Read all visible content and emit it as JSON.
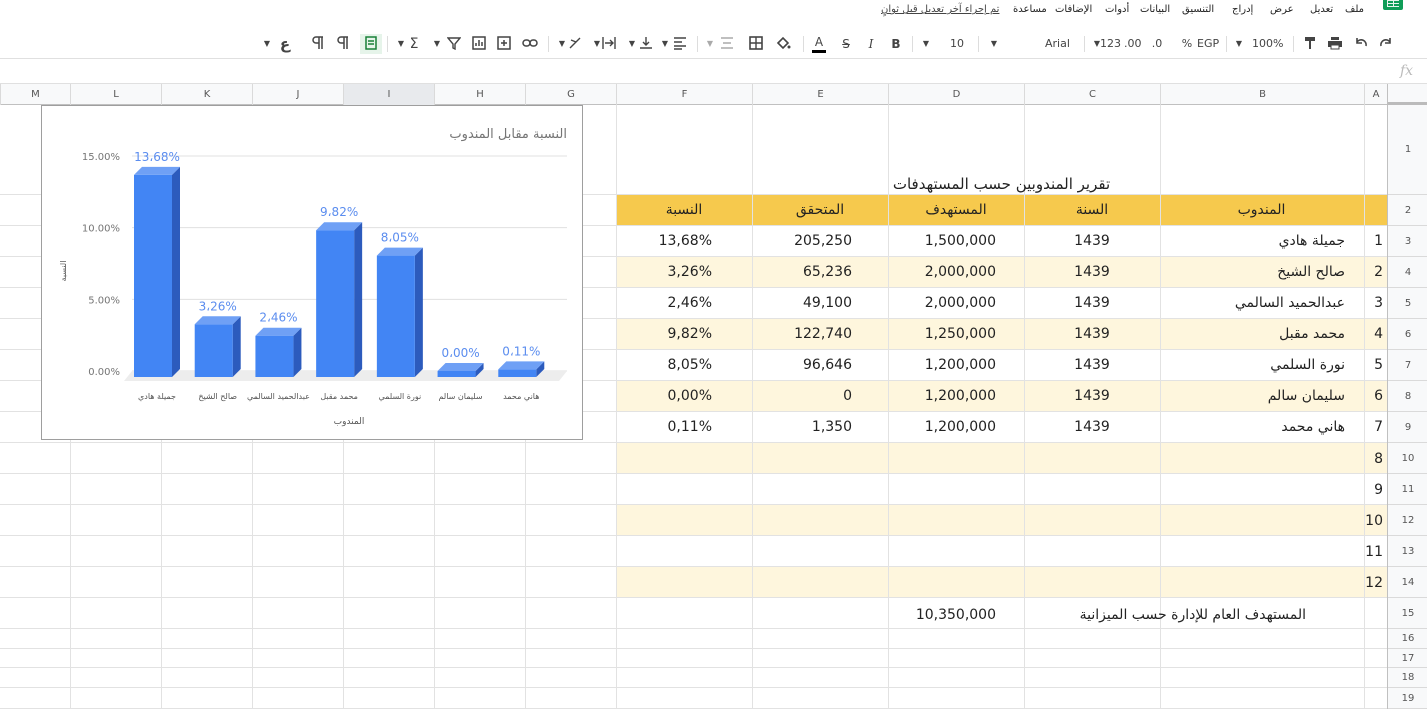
{
  "menu": {
    "items": [
      "ملف",
      "تعديل",
      "عرض",
      "إدراج",
      "التنسيق",
      "البيانات",
      "أدوات",
      "الإضافات",
      "مساعدة"
    ],
    "last_edit": "تم إجراء آخر تعديل قبل ثوانٍ"
  },
  "toolbar": {
    "zoom": "100%",
    "currency": "EGP",
    "percent": "%",
    "dec_less": ".0",
    "dec_more": ".00",
    "num_format": "123",
    "font": "Arial",
    "font_size": "10",
    "bold": "B",
    "italic": "I",
    "strike": "S",
    "text_color": "A",
    "sum": "Σ",
    "rtl": "ع"
  },
  "colors": {
    "accent": "#4285f4",
    "header_fill": "#f6c94d",
    "band_fill": "#fef6dd",
    "bar": "#4285f4",
    "bar_side": "#2c5bbd",
    "bar_top": "#6fa0f5"
  },
  "columns": [
    "A",
    "B",
    "C",
    "D",
    "E",
    "F",
    "G",
    "H",
    "I",
    "J",
    "K",
    "L",
    "M"
  ],
  "rows": [
    "1",
    "2",
    "3",
    "4",
    "5",
    "6",
    "7",
    "8",
    "9",
    "10",
    "11",
    "12",
    "13",
    "14",
    "15",
    "16",
    "17",
    "18",
    "19"
  ],
  "sheet": {
    "title": "تقرير المندوبين حسب المستهدفات",
    "headers": {
      "rep": "المندوب",
      "year": "السنة",
      "target": "المستهدف",
      "achieved": "المتحقق",
      "ratio": "النسبة"
    },
    "records": [
      {
        "no": "1",
        "rep": "جميلة هادي",
        "year": "1439",
        "target": "1,500,000",
        "achieved": "205,250",
        "ratio": "13,68%"
      },
      {
        "no": "2",
        "rep": "صالح الشيخ",
        "year": "1439",
        "target": "2,000,000",
        "achieved": "65,236",
        "ratio": "3,26%"
      },
      {
        "no": "3",
        "rep": "عبدالحميد السالمي",
        "year": "1439",
        "target": "2,000,000",
        "achieved": "49,100",
        "ratio": "2,46%"
      },
      {
        "no": "4",
        "rep": "محمد مقبل",
        "year": "1439",
        "target": "1,250,000",
        "achieved": "122,740",
        "ratio": "9,82%"
      },
      {
        "no": "5",
        "rep": "نورة السلمي",
        "year": "1439",
        "target": "1,200,000",
        "achieved": "96,646",
        "ratio": "8,05%"
      },
      {
        "no": "6",
        "rep": "سليمان سالم",
        "year": "1439",
        "target": "1,200,000",
        "achieved": "0",
        "ratio": "0,00%"
      },
      {
        "no": "7",
        "rep": "هاني محمد",
        "year": "1439",
        "target": "1,200,000",
        "achieved": "1,350",
        "ratio": "0,11%"
      }
    ],
    "empty_nos": [
      "8",
      "9",
      "10",
      "11",
      "12"
    ],
    "total_label": "المستهدف العام للإدارة حسب الميزانية",
    "total_value": "10,350,000"
  },
  "chart_data": {
    "type": "bar",
    "title": "النسبة مقابل المندوب",
    "xlabel": "المندوب",
    "ylabel": "النسبة",
    "categories": [
      "جميلة هادي",
      "صالح الشيخ",
      "عبدالحميد السالمي",
      "محمد مقبل",
      "نورة السلمي",
      "سليمان سالم",
      "هاني محمد"
    ],
    "values": [
      13.68,
      3.26,
      2.46,
      9.82,
      8.05,
      0.0,
      0.11
    ],
    "value_labels": [
      "13،68%",
      "3،26%",
      "2،46%",
      "9،82%",
      "8،05%",
      "0،00%",
      "0،11%"
    ],
    "yticks": [
      "0.00%",
      "5.00%",
      "10.00%",
      "15.00%"
    ],
    "ylim": [
      0,
      15
    ],
    "grid": true,
    "legend": "none"
  }
}
